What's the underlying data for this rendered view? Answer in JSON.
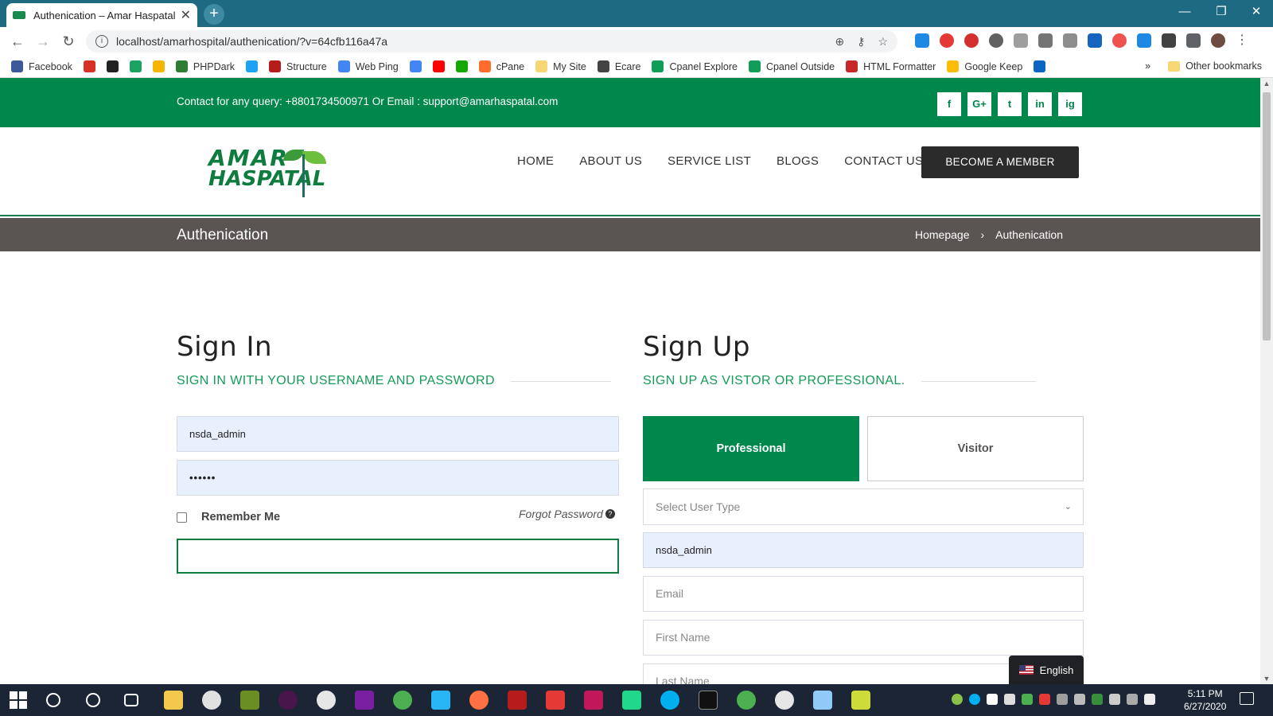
{
  "browser": {
    "tab_title": "Authenication – Amar Haspatal",
    "url": "localhost/amarhospital/authenication/?v=64cfb116a47a",
    "bookmarks": [
      {
        "label": "Facebook",
        "icon": "facebook-icon",
        "color": "#3b5998"
      },
      {
        "label": "",
        "icon": "gmail-icon",
        "color": "#d93025"
      },
      {
        "label": "",
        "icon": "github-icon",
        "color": "#222222"
      },
      {
        "label": "",
        "icon": "ft-icon",
        "color": "#1aa260"
      },
      {
        "label": "",
        "icon": "drive-icon",
        "color": "#f4b400"
      },
      {
        "label": "PHPDark",
        "icon": "phpdark-icon",
        "color": "#2e7d32"
      },
      {
        "label": "",
        "icon": "twitter-icon",
        "color": "#1da1f2"
      },
      {
        "label": "Structure",
        "icon": "structure-icon",
        "color": "#b71c1c"
      },
      {
        "label": "Web Ping",
        "icon": "google-icon",
        "color": "#4285f4"
      },
      {
        "label": "",
        "icon": "translate-icon",
        "color": "#4285f4"
      },
      {
        "label": "",
        "icon": "youtube-icon",
        "color": "#ff0000"
      },
      {
        "label": "",
        "icon": "upwork-icon",
        "color": "#14a800"
      },
      {
        "label": "cPane",
        "icon": "cpanel-icon",
        "color": "#ff6c2c"
      },
      {
        "label": "My Site",
        "icon": "folder-icon",
        "color": "#f7d774"
      },
      {
        "label": "Ecare",
        "icon": "globe-icon",
        "color": "#444444"
      },
      {
        "label": "Cpanel Explore",
        "icon": "cpanel-explore-icon",
        "color": "#0f9d58"
      },
      {
        "label": "Cpanel Outside",
        "icon": "cpanel-outside-icon",
        "color": "#0f9d58"
      },
      {
        "label": "HTML Formatter",
        "icon": "html-formatter-icon",
        "color": "#c62828"
      },
      {
        "label": "Google Keep",
        "icon": "google-keep-icon",
        "color": "#fbbc04"
      },
      {
        "label": "",
        "icon": "linkedin-icon",
        "color": "#0a66c2"
      }
    ],
    "overflow_label": "»",
    "other_bookmarks": "Other bookmarks"
  },
  "topbar": {
    "contact": "Contact for any query: +8801734500971 Or Email : support@amarhaspatal.com",
    "socials": [
      "f",
      "G+",
      "t",
      "in",
      "ig"
    ]
  },
  "logo": {
    "line1": "AMAR",
    "line2": "HASPATAL"
  },
  "nav": {
    "items": [
      "HOME",
      "ABOUT US",
      "SERVICE LIST",
      "BLOGS",
      "CONTACT US"
    ],
    "cta": "BECOME A MEMBER"
  },
  "breadcrumb": {
    "title": "Authenication",
    "home": "Homepage",
    "separator": "›",
    "current": "Authenication"
  },
  "signin": {
    "title": "Sign In",
    "subtitle": "SIGN IN WITH YOUR USERNAME AND PASSWORD",
    "username_value": "nsda_admin",
    "password_value": "••••••",
    "remember_label": "Remember Me",
    "forgot_label": "Forgot Password"
  },
  "signup": {
    "title": "Sign Up",
    "subtitle": "SIGN UP AS VISTOR OR PROFESSIONAL.",
    "tab_professional": "Professional",
    "tab_visitor": "Visitor",
    "select_placeholder": "Select User Type",
    "username_value": "nsda_admin",
    "email_placeholder": "Email",
    "firstname_placeholder": "First Name",
    "lastname_placeholder": "Last Name"
  },
  "language": "English",
  "taskbar": {
    "time": "5:11 PM",
    "date": "6/27/2020"
  },
  "colors": {
    "brand_green": "#00874c",
    "breadcrumb_bg": "#5a5452",
    "cta_dark": "#2b2b2b"
  }
}
